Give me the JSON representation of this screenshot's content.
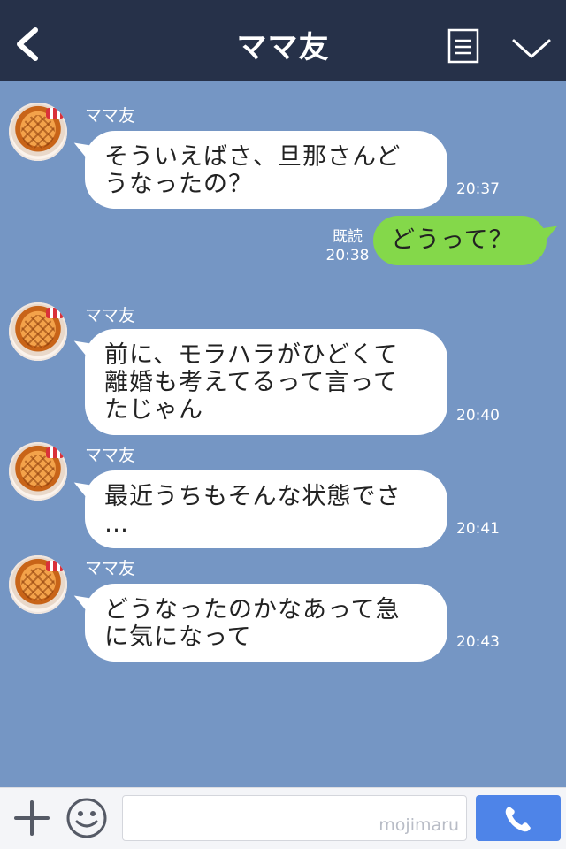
{
  "header": {
    "title": "ママ友"
  },
  "messages": [
    {
      "sender": "ママ友",
      "text_lines": [
        "そういえばさ、旦那さんど",
        "うなったの？"
      ],
      "time": "20:37"
    },
    {
      "outgoing": true,
      "read_label": "既読",
      "time": "20:38",
      "text": "どうって？"
    },
    {
      "sender": "ママ友",
      "text_lines": [
        "前に、モラハラがひどくて",
        "離婚も考えてるって言って",
        "たじゃん"
      ],
      "time": "20:40"
    },
    {
      "sender": "ママ友",
      "text_lines": [
        "最近うちもそんな状態でさ",
        "…"
      ],
      "time": "20:41"
    },
    {
      "sender": "ママ友",
      "text_lines": [
        "どうなったのかなあって急",
        "に気になって"
      ],
      "time": "20:43"
    }
  ],
  "footer": {
    "watermark": "mojimaru"
  },
  "colors": {
    "header_bg": "#263149",
    "chat_bg": "#7596c4",
    "outgoing_bubble": "#84d84a",
    "incoming_bubble": "#ffffff",
    "call_button": "#4e84e8"
  },
  "icons": [
    "back-chevron-icon",
    "menu-list-icon",
    "chevron-down-icon",
    "plus-icon",
    "smiley-icon",
    "phone-icon"
  ]
}
